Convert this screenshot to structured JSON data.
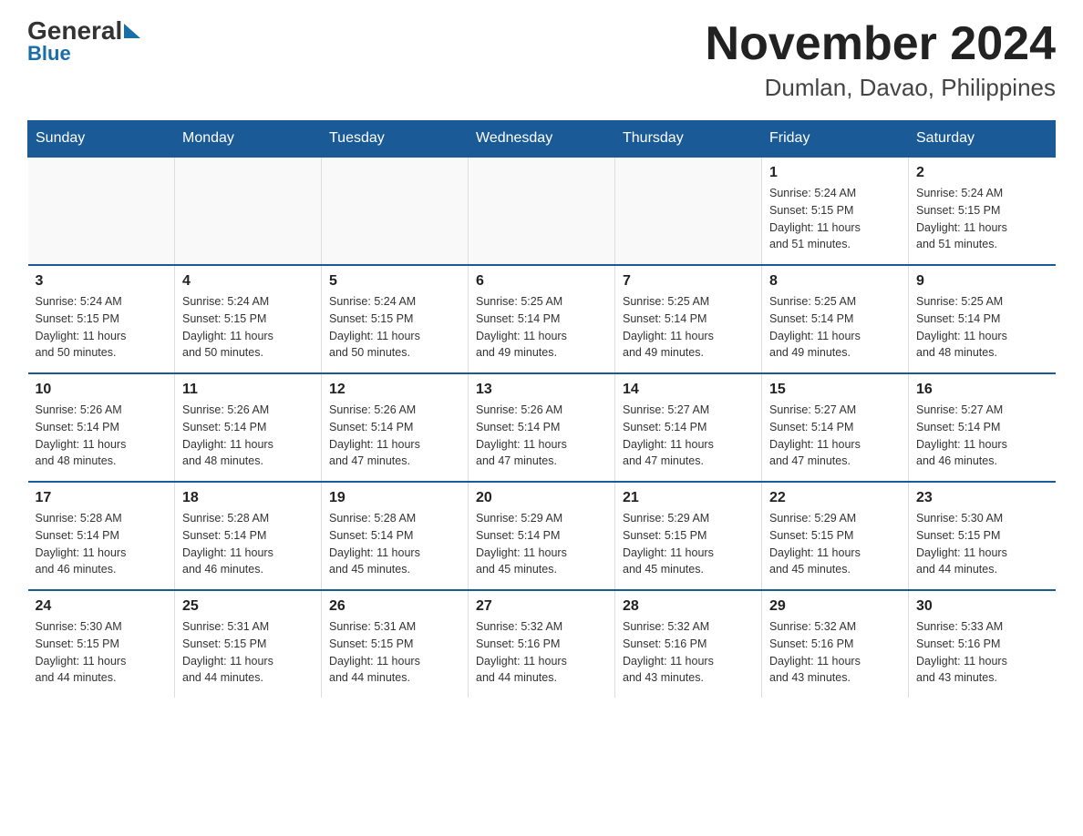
{
  "logo": {
    "general": "General",
    "blue": "Blue"
  },
  "title": "November 2024",
  "subtitle": "Dumlan, Davao, Philippines",
  "days_of_week": [
    "Sunday",
    "Monday",
    "Tuesday",
    "Wednesday",
    "Thursday",
    "Friday",
    "Saturday"
  ],
  "weeks": [
    [
      {
        "day": "",
        "info": ""
      },
      {
        "day": "",
        "info": ""
      },
      {
        "day": "",
        "info": ""
      },
      {
        "day": "",
        "info": ""
      },
      {
        "day": "",
        "info": ""
      },
      {
        "day": "1",
        "info": "Sunrise: 5:24 AM\nSunset: 5:15 PM\nDaylight: 11 hours\nand 51 minutes."
      },
      {
        "day": "2",
        "info": "Sunrise: 5:24 AM\nSunset: 5:15 PM\nDaylight: 11 hours\nand 51 minutes."
      }
    ],
    [
      {
        "day": "3",
        "info": "Sunrise: 5:24 AM\nSunset: 5:15 PM\nDaylight: 11 hours\nand 50 minutes."
      },
      {
        "day": "4",
        "info": "Sunrise: 5:24 AM\nSunset: 5:15 PM\nDaylight: 11 hours\nand 50 minutes."
      },
      {
        "day": "5",
        "info": "Sunrise: 5:24 AM\nSunset: 5:15 PM\nDaylight: 11 hours\nand 50 minutes."
      },
      {
        "day": "6",
        "info": "Sunrise: 5:25 AM\nSunset: 5:14 PM\nDaylight: 11 hours\nand 49 minutes."
      },
      {
        "day": "7",
        "info": "Sunrise: 5:25 AM\nSunset: 5:14 PM\nDaylight: 11 hours\nand 49 minutes."
      },
      {
        "day": "8",
        "info": "Sunrise: 5:25 AM\nSunset: 5:14 PM\nDaylight: 11 hours\nand 49 minutes."
      },
      {
        "day": "9",
        "info": "Sunrise: 5:25 AM\nSunset: 5:14 PM\nDaylight: 11 hours\nand 48 minutes."
      }
    ],
    [
      {
        "day": "10",
        "info": "Sunrise: 5:26 AM\nSunset: 5:14 PM\nDaylight: 11 hours\nand 48 minutes."
      },
      {
        "day": "11",
        "info": "Sunrise: 5:26 AM\nSunset: 5:14 PM\nDaylight: 11 hours\nand 48 minutes."
      },
      {
        "day": "12",
        "info": "Sunrise: 5:26 AM\nSunset: 5:14 PM\nDaylight: 11 hours\nand 47 minutes."
      },
      {
        "day": "13",
        "info": "Sunrise: 5:26 AM\nSunset: 5:14 PM\nDaylight: 11 hours\nand 47 minutes."
      },
      {
        "day": "14",
        "info": "Sunrise: 5:27 AM\nSunset: 5:14 PM\nDaylight: 11 hours\nand 47 minutes."
      },
      {
        "day": "15",
        "info": "Sunrise: 5:27 AM\nSunset: 5:14 PM\nDaylight: 11 hours\nand 47 minutes."
      },
      {
        "day": "16",
        "info": "Sunrise: 5:27 AM\nSunset: 5:14 PM\nDaylight: 11 hours\nand 46 minutes."
      }
    ],
    [
      {
        "day": "17",
        "info": "Sunrise: 5:28 AM\nSunset: 5:14 PM\nDaylight: 11 hours\nand 46 minutes."
      },
      {
        "day": "18",
        "info": "Sunrise: 5:28 AM\nSunset: 5:14 PM\nDaylight: 11 hours\nand 46 minutes."
      },
      {
        "day": "19",
        "info": "Sunrise: 5:28 AM\nSunset: 5:14 PM\nDaylight: 11 hours\nand 45 minutes."
      },
      {
        "day": "20",
        "info": "Sunrise: 5:29 AM\nSunset: 5:14 PM\nDaylight: 11 hours\nand 45 minutes."
      },
      {
        "day": "21",
        "info": "Sunrise: 5:29 AM\nSunset: 5:15 PM\nDaylight: 11 hours\nand 45 minutes."
      },
      {
        "day": "22",
        "info": "Sunrise: 5:29 AM\nSunset: 5:15 PM\nDaylight: 11 hours\nand 45 minutes."
      },
      {
        "day": "23",
        "info": "Sunrise: 5:30 AM\nSunset: 5:15 PM\nDaylight: 11 hours\nand 44 minutes."
      }
    ],
    [
      {
        "day": "24",
        "info": "Sunrise: 5:30 AM\nSunset: 5:15 PM\nDaylight: 11 hours\nand 44 minutes."
      },
      {
        "day": "25",
        "info": "Sunrise: 5:31 AM\nSunset: 5:15 PM\nDaylight: 11 hours\nand 44 minutes."
      },
      {
        "day": "26",
        "info": "Sunrise: 5:31 AM\nSunset: 5:15 PM\nDaylight: 11 hours\nand 44 minutes."
      },
      {
        "day": "27",
        "info": "Sunrise: 5:32 AM\nSunset: 5:16 PM\nDaylight: 11 hours\nand 44 minutes."
      },
      {
        "day": "28",
        "info": "Sunrise: 5:32 AM\nSunset: 5:16 PM\nDaylight: 11 hours\nand 43 minutes."
      },
      {
        "day": "29",
        "info": "Sunrise: 5:32 AM\nSunset: 5:16 PM\nDaylight: 11 hours\nand 43 minutes."
      },
      {
        "day": "30",
        "info": "Sunrise: 5:33 AM\nSunset: 5:16 PM\nDaylight: 11 hours\nand 43 minutes."
      }
    ]
  ]
}
